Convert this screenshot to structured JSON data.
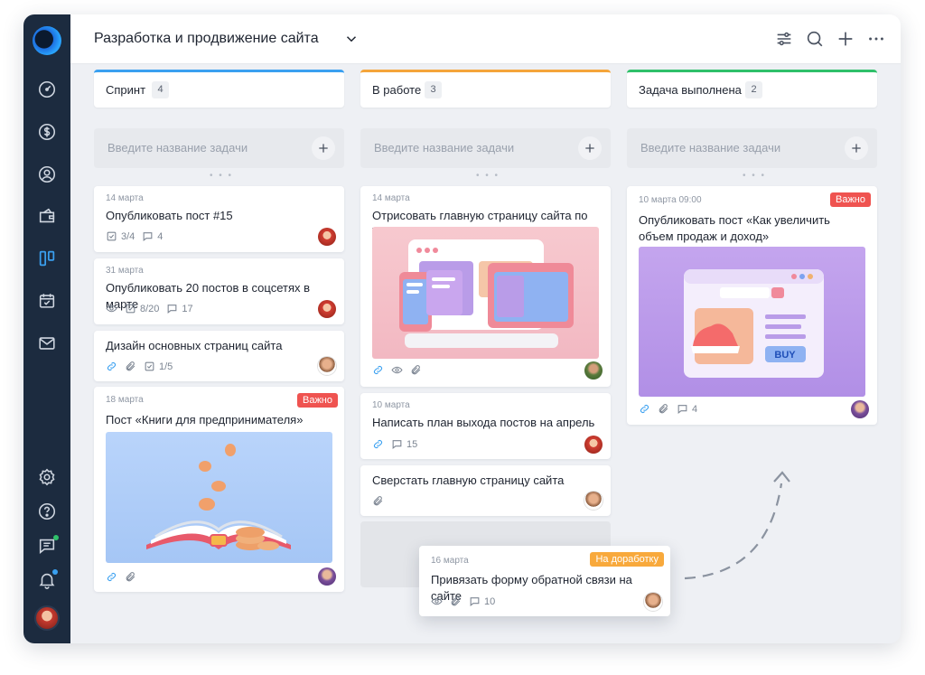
{
  "header": {
    "title": "Разработка и продвижение сайта"
  },
  "new_task_placeholder": "Введите название задачи",
  "columns": [
    {
      "title": "Спринт",
      "count": "4",
      "color": "#3aa0f0",
      "cards": [
        {
          "date": "14 марта",
          "title": "Опубликовать пост #15",
          "checklist": "3/4",
          "comments": "4"
        },
        {
          "date": "31 марта",
          "title": "Опубликовать 20 постов в соцсетях в марте",
          "checklist": "8/20",
          "comments": "17"
        },
        {
          "title": "Дизайн основных страниц сайта",
          "checklist": "1/5"
        },
        {
          "date": "18 марта",
          "title": "Пост «Книги для предпринимателя»",
          "badge": "Важно"
        }
      ]
    },
    {
      "title": "В работе",
      "count": "3",
      "color": "#f5a53a",
      "cards": [
        {
          "date": "14 марта",
          "title": "Отрисовать главную страницу сайта по ТЗ"
        },
        {
          "date": "10 марта",
          "title": "Написать план выхода постов на апрель",
          "comments": "15"
        },
        {
          "title": "Сверстать главную страницу сайта"
        }
      ]
    },
    {
      "title": "Задача выполнена",
      "count": "2",
      "color": "#2fc06a",
      "cards": [
        {
          "date": "10 марта 09:00",
          "title": "Опубликовать пост «Как увеличить объем продаж и доход»",
          "badge": "Важно",
          "comments": "4",
          "image_button": "BUY"
        }
      ]
    }
  ],
  "dragged_card": {
    "date": "16 марта",
    "title": "Привязать форму обратной связи на сайте",
    "badge": "На доработку",
    "comments": "10"
  },
  "colors": {
    "important": "#ef5350",
    "rework": "#f8a93c",
    "sidebar": "#1c2b3f"
  }
}
